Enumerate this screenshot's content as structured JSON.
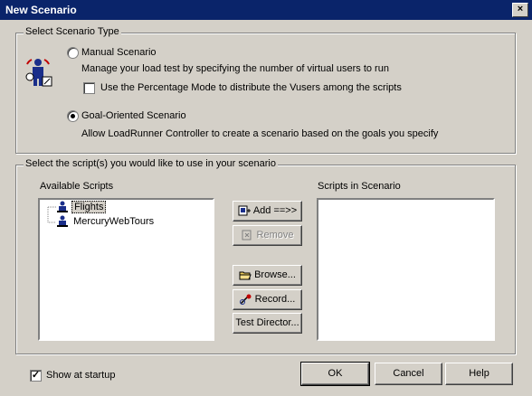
{
  "window": {
    "title": "New Scenario",
    "close_glyph": "×"
  },
  "scenario_type": {
    "group_title": "Select Scenario Type",
    "manual": {
      "label": "Manual Scenario",
      "description": "Manage your load test by specifying the number of virtual users to run",
      "selected": false,
      "percentage_mode": {
        "label": "Use the Percentage Mode to distribute the Vusers among the scripts",
        "checked": false
      }
    },
    "goal": {
      "label": "Goal-Oriented Scenario",
      "description": "Allow LoadRunner Controller to create a scenario based on the goals you specify",
      "selected": true
    }
  },
  "scripts": {
    "group_title": "Select the script(s) you would like to use in your scenario",
    "available_label": "Available Scripts",
    "in_scenario_label": "Scripts in Scenario",
    "available": [
      {
        "name": "Flights",
        "selected": true
      },
      {
        "name": "MercuryWebTours",
        "selected": false
      }
    ],
    "in_scenario": []
  },
  "buttons": {
    "add": {
      "label": "Add ==>>",
      "icon": "add-script-icon",
      "enabled": true
    },
    "remove": {
      "label": "Remove",
      "icon": "remove-script-icon",
      "enabled": false
    },
    "browse": {
      "label": "Browse...",
      "icon": "folder-icon",
      "enabled": true
    },
    "record": {
      "label": "Record...",
      "icon": "record-icon",
      "enabled": true
    },
    "test_director": {
      "label": "Test Director...",
      "enabled": true
    },
    "ok": "OK",
    "cancel": "Cancel",
    "help": "Help"
  },
  "footer": {
    "show_at_startup": {
      "label": "Show at startup",
      "checked": true
    }
  },
  "colors": {
    "titlebar": "#0a246a",
    "face": "#d4d0c8"
  }
}
